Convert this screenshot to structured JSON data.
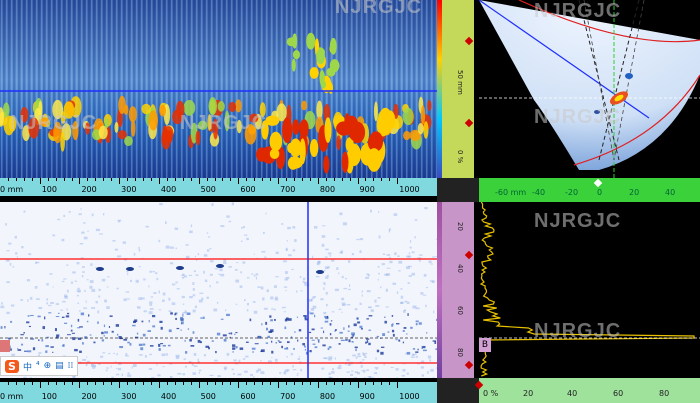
{
  "watermark": "NJRGJC",
  "top_scan": {
    "ruler_unit": "0 mm",
    "ruler_ticks": [
      "100",
      "200",
      "300",
      "400",
      "500",
      "600",
      "700",
      "800",
      "900",
      "1000"
    ]
  },
  "bottom_scan": {
    "ruler_unit": "0 mm",
    "ruler_ticks": [
      "100",
      "200",
      "300",
      "400",
      "500",
      "600",
      "700",
      "800",
      "900",
      "1000"
    ]
  },
  "side_ruler_top": {
    "labels": [
      "50 mm",
      "0 %"
    ]
  },
  "side_ruler_mid": {
    "labels": [
      "50",
      "0 %"
    ]
  },
  "side_ruler_bottom": {
    "labels": [
      "20",
      "40",
      "60",
      "80"
    ]
  },
  "side_ruler_bottom2": {
    "labels": [
      "20",
      "40",
      "60"
    ]
  },
  "sector_ruler": {
    "labels": [
      "-60 mm",
      "-40",
      "-20",
      "0",
      "20",
      "40"
    ]
  },
  "amp_ruler": {
    "labels": [
      "0 %",
      "20",
      "40",
      "60",
      "80"
    ]
  },
  "marker_b": "B",
  "ime_toolbar": {
    "logo": "S",
    "items": [
      "中",
      "⁴",
      "⊕",
      "▤",
      "⁞⁞"
    ]
  },
  "colors": {
    "cursor_blue": "#1f2fff",
    "gate_red": "#ff3030",
    "ruler_cyan": "#7fd9df",
    "ruler_yellowgreen": "#c4d95a",
    "ruler_green": "#3bd13b",
    "amp_trace": "#e8c000"
  }
}
